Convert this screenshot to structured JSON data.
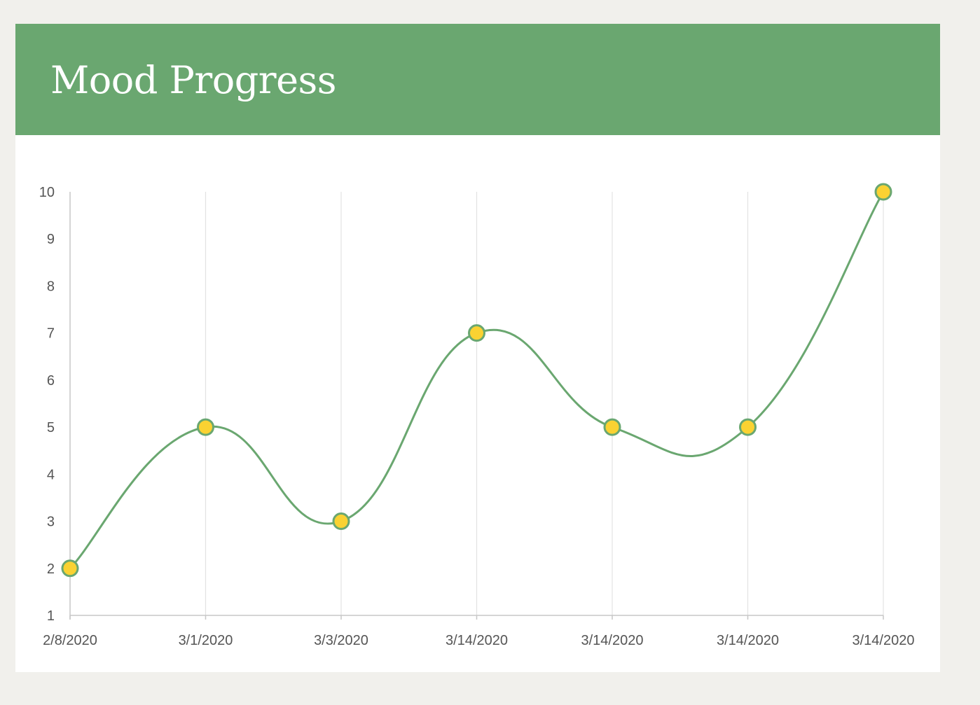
{
  "title": "Mood Progress",
  "colors": {
    "page_background": "#f1f0ec",
    "card_background": "#ffffff",
    "header": "#6aa770",
    "line": "#6aa770",
    "point_fill": "#fad232",
    "grid": "#e2e2e2",
    "axis": "#c7c7c7",
    "tick_text": "#555555"
  },
  "chart_data": {
    "type": "line",
    "title": "Mood Progress",
    "xlabel": "",
    "ylabel": "",
    "categories": [
      "2/8/2020",
      "3/1/2020",
      "3/3/2020",
      "3/14/2020",
      "3/14/2020",
      "3/14/2020",
      "3/14/2020"
    ],
    "series": [
      {
        "values": [
          2,
          5,
          3,
          7,
          5,
          5,
          10
        ]
      }
    ],
    "ylim": [
      1,
      10
    ],
    "yticks": [
      1,
      2,
      3,
      4,
      5,
      6,
      7,
      8,
      9,
      10
    ],
    "grid": {
      "vertical": true,
      "horizontal": false
    },
    "curve": "smooth",
    "markers": true,
    "legend": "none"
  }
}
